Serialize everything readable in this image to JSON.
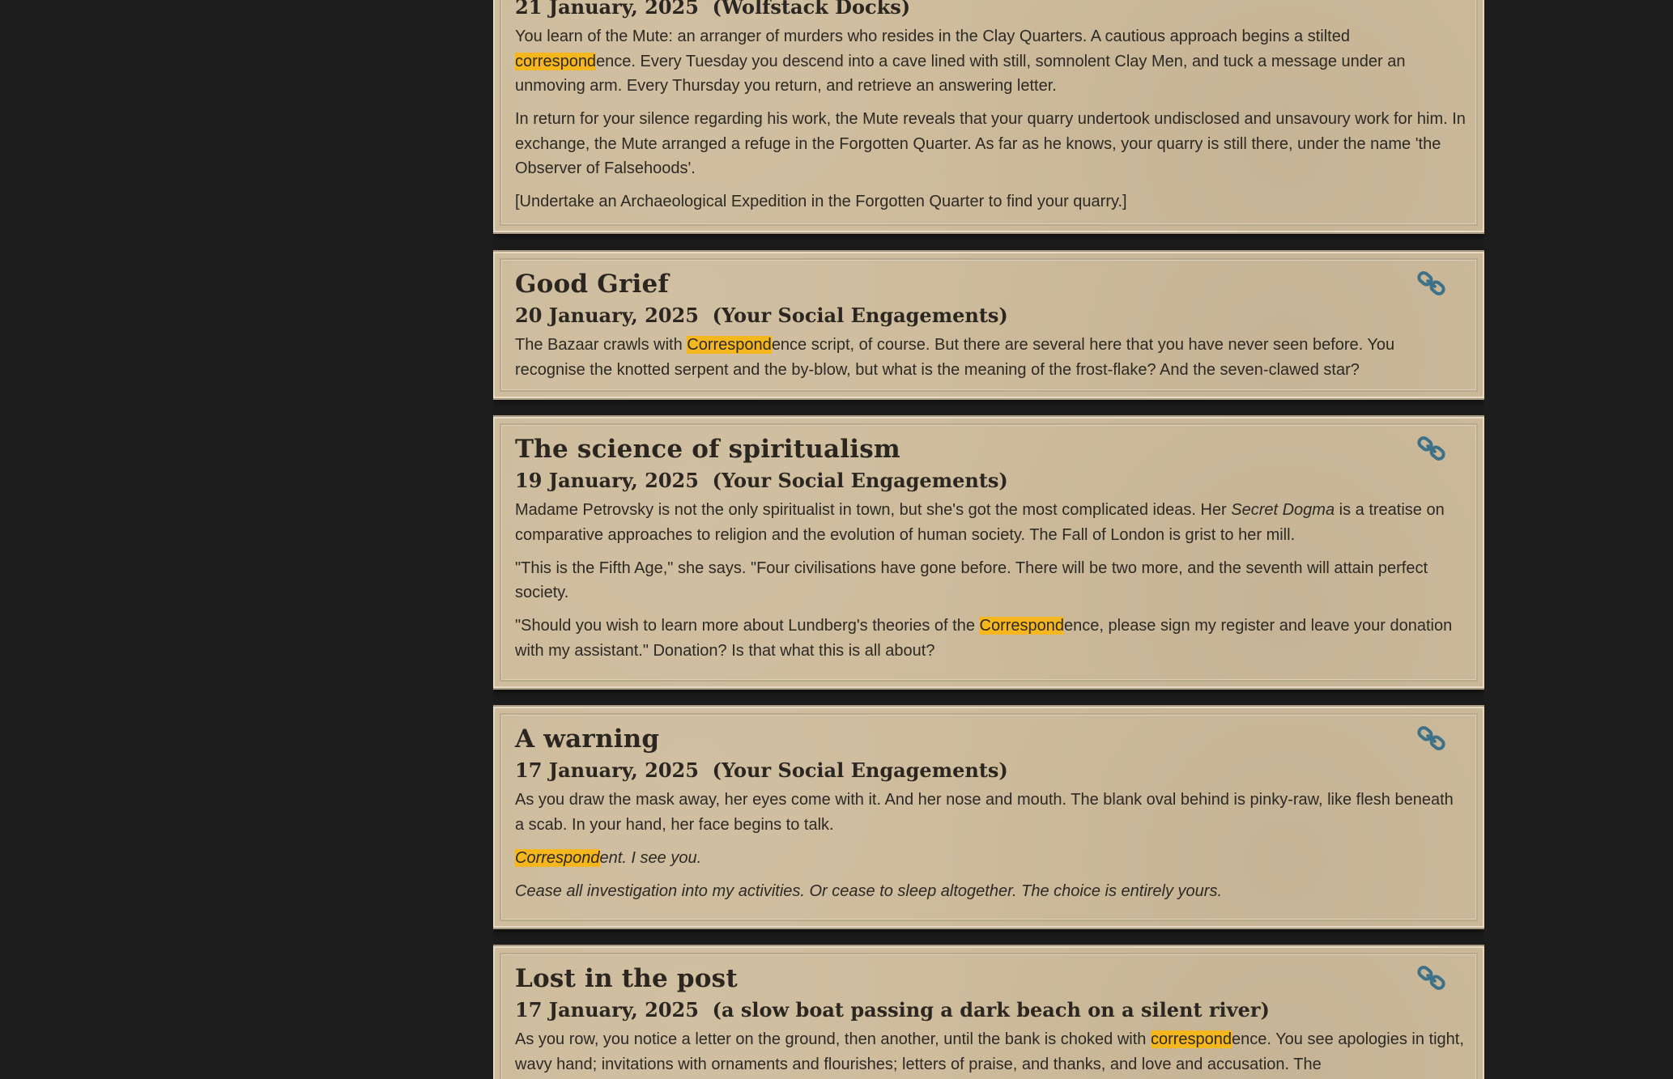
{
  "colors": {
    "background": "#1d1d1d",
    "card": "#cdbb9b",
    "highlight": "#f6b71e",
    "link_icon": "#3d7187",
    "text": "#2d2924"
  },
  "entries": [
    {
      "subtitle": "21 January, 2025  (Wolfstack Docks)",
      "paragraphs": [
        [
          {
            "t": "You learn of the Mute: an arranger of murders who resides in the Clay Quarters. A cautious approach begins a stilted "
          },
          {
            "t": "correspond",
            "hl": true
          },
          {
            "t": "ence. Every Tuesday you descend into a cave lined with still, somnolent Clay Men, and tuck a message under an unmoving arm. Every Thursday you return, and retrieve an answering letter."
          }
        ],
        [
          {
            "t": "In return for your silence regarding his work, the Mute reveals that your quarry undertook undisclosed and unsavoury work for him. In exchange, the Mute arranged a refuge in the Forgotten Quarter. As far as he knows, your quarry is still there, under the name 'the Observer of Falsehoods'."
          }
        ],
        [
          {
            "t": "[Undertake an Archaeological Expedition in the Forgotten Quarter to find your quarry.]"
          }
        ]
      ]
    },
    {
      "title": "Good Grief",
      "subtitle": "20 January, 2025  (Your Social Engagements)",
      "icon": "link-icon",
      "paragraphs": [
        [
          {
            "t": "The Bazaar crawls with "
          },
          {
            "t": "Correspond",
            "hl": true
          },
          {
            "t": "ence script, of course. But there are several here that you have never seen before. You recognise the knotted serpent and the by-blow, but what is the meaning of the frost-flake? And the seven-clawed star?"
          }
        ]
      ]
    },
    {
      "title": "The science of spiritualism",
      "subtitle": "19 January, 2025  (Your Social Engagements)",
      "icon": "link-icon",
      "paragraphs": [
        [
          {
            "t": "Madame Petrovsky is not the only spiritualist in town, but she's got the most complicated ideas. Her "
          },
          {
            "t": "Secret Dogma",
            "it": true
          },
          {
            "t": " is a treatise on comparative approaches to religion and the evolution of human society. The Fall of London is grist to her mill."
          }
        ],
        [
          {
            "t": "\"This is the Fifth Age,\" she says. \"Four civilisations have gone before. There will be two more, and the seventh will attain perfect society."
          }
        ],
        [
          {
            "t": "\"Should you wish to learn more about Lundberg's theories of the "
          },
          {
            "t": "Correspond",
            "hl": true
          },
          {
            "t": "ence, please sign my register and leave your donation with my assistant.\" Donation? Is that what this is all about?"
          }
        ]
      ]
    },
    {
      "title": "A warning",
      "subtitle": "17 January, 2025  (Your Social Engagements)",
      "icon": "link-icon",
      "paragraphs": [
        [
          {
            "t": "As you draw the mask away, her eyes come with it. And her nose and mouth. The blank oval behind is pinky-raw, like flesh beneath a scab. In your hand, her face begins to talk."
          }
        ],
        [
          {
            "t": "Correspond",
            "hl": true,
            "it": true
          },
          {
            "t": "ent. I see you.",
            "it": true
          }
        ],
        [
          {
            "t": "Cease all investigation into my activities. Or cease to sleep altogether. The choice is entirely yours.",
            "it": true
          }
        ]
      ]
    },
    {
      "title": "Lost in the post",
      "subtitle": "17 January, 2025  (a slow boat passing a dark beach on a silent river)",
      "icon": "link-icon",
      "paragraphs": [
        [
          {
            "t": "As you row, you notice a letter on the ground, then another, until the bank is choked with "
          },
          {
            "t": "correspond",
            "hl": true
          },
          {
            "t": "ence. You see apologies in tight, wavy hand; invitations with ornaments and flourishes; letters of praise, and thanks, and love and accusation. The"
          }
        ]
      ]
    }
  ]
}
